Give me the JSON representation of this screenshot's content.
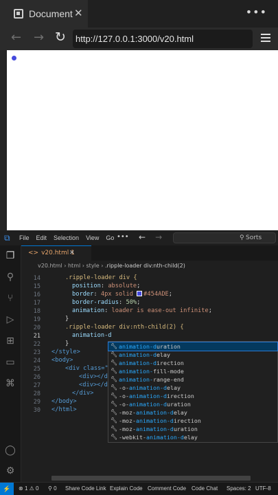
{
  "browser": {
    "tab_title": "Document",
    "url": "http://127.0.0.1:3000/v20.html"
  },
  "vscode": {
    "menus": [
      "File",
      "Edit",
      "Selection",
      "View",
      "Go"
    ],
    "search_label": "Sorts",
    "editor_tab": "v20.html",
    "editor_tab_badge": "1",
    "breadcrumbs": [
      "v20.html",
      "html",
      "style",
      ".ripple-loader div:nth-child(2)"
    ],
    "code": {
      "14": ".ripple-loader div {",
      "15_prop": "position",
      "15_val": "absolute",
      "16_prop": "border",
      "16_val": "4px solid ",
      "16_color": "#454ADE",
      "17_prop": "border-radius",
      "17_val": "50%",
      "18_prop": "animation",
      "18_val": "loader is ease-out infinite",
      "19": "}",
      "20": ".ripple-loader div:nth-child(2) {",
      "21": "animation-d",
      "22": "}",
      "23": "</style>",
      "24": "<body>",
      "25_a": "<div class=\"",
      "26": "<div></di",
      "27": "<div></di",
      "28": "</div>",
      "29": "</body>",
      "30": "</html>"
    },
    "line_numbers": [
      "14",
      "15",
      "16",
      "17",
      "18",
      "19",
      "20",
      "21",
      "22",
      "23",
      "24",
      "25",
      "26",
      "27",
      "28",
      "29",
      "30"
    ],
    "suggestions": [
      {
        "pre": "",
        "match": "animation-d",
        "post": "uration"
      },
      {
        "pre": "",
        "match": "animation-d",
        "post": "elay"
      },
      {
        "pre": "",
        "match": "animation-d",
        "post": "irection"
      },
      {
        "pre": "",
        "match": "animation-",
        "post": "fill-mode"
      },
      {
        "pre": "",
        "match": "animation-",
        "post": "range-end"
      },
      {
        "pre": "-o-",
        "match": "animation-d",
        "post": "elay"
      },
      {
        "pre": "-o-",
        "match": "animation-d",
        "post": "irection"
      },
      {
        "pre": "-o-",
        "match": "animation-d",
        "post": "uration"
      },
      {
        "pre": "-moz-",
        "match": "animation-d",
        "post": "elay"
      },
      {
        "pre": "-moz-",
        "match": "animation-d",
        "post": "irection"
      },
      {
        "pre": "-moz-",
        "match": "animation-d",
        "post": "uration"
      },
      {
        "pre": "-webkit-",
        "match": "animation-d",
        "post": "elay"
      }
    ],
    "status": {
      "errors": "1",
      "warnings": "0",
      "ports": "0",
      "share": "Share Code Link",
      "explain": "Explain Code",
      "comment": "Comment Code",
      "chat": "Code Chat",
      "spaces": "Spaces: 2",
      "encoding": "UTF-8"
    }
  }
}
